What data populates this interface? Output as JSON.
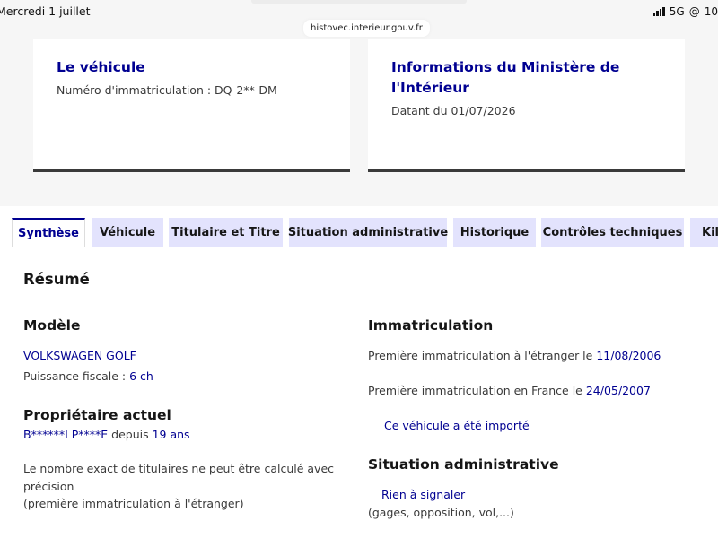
{
  "status_bar": {
    "date": "Mercredi 1 juillet",
    "network": "5G",
    "battery_partial": "10",
    "url": "histovec.interieur.gouv.fr"
  },
  "vehicle_card": {
    "title": "Le véhicule",
    "plate_label": "Numéro d'immatriculation : ",
    "plate_value": "DQ-2**-DM"
  },
  "ministry_card": {
    "title": "Informations du Ministère de l'Intérieur",
    "date_text": "Datant du 01/07/2026"
  },
  "tabs": [
    {
      "label": "Synthèse",
      "active": true
    },
    {
      "label": "Véhicule",
      "active": false
    },
    {
      "label": "Titulaire et Titre",
      "active": false
    },
    {
      "label": "Situation administrative",
      "active": false
    },
    {
      "label": "Historique",
      "active": false
    },
    {
      "label": "Contrôles techniques",
      "active": false
    },
    {
      "label": "Kilo",
      "active": false
    }
  ],
  "summary": {
    "title": "Résumé",
    "model": {
      "heading": "Modèle",
      "name": "VOLKSWAGEN GOLF",
      "power_label": "Puissance fiscale : ",
      "power_value": "6 ch"
    },
    "owner": {
      "heading": "Propriétaire actuel",
      "name": "B******I P****E",
      "since_label": " depuis ",
      "since_value": "19 ans",
      "note_line1": "Le nombre exact de titulaires ne peut être calculé avec",
      "note_line2": "précision",
      "note_line3": "(première immatriculation à l'étranger)"
    },
    "registration": {
      "heading": "Immatriculation",
      "foreign_label": "Première immatriculation à l'étranger le ",
      "foreign_date": "11/08/2006",
      "france_label": "Première immatriculation en France le ",
      "france_date": "24/05/2007",
      "imported_link": "Ce véhicule a été importé"
    },
    "admin_situation": {
      "heading": "Situation administrative",
      "status": "Rien à signaler",
      "detail": "(gages, opposition, vol,...)"
    }
  }
}
